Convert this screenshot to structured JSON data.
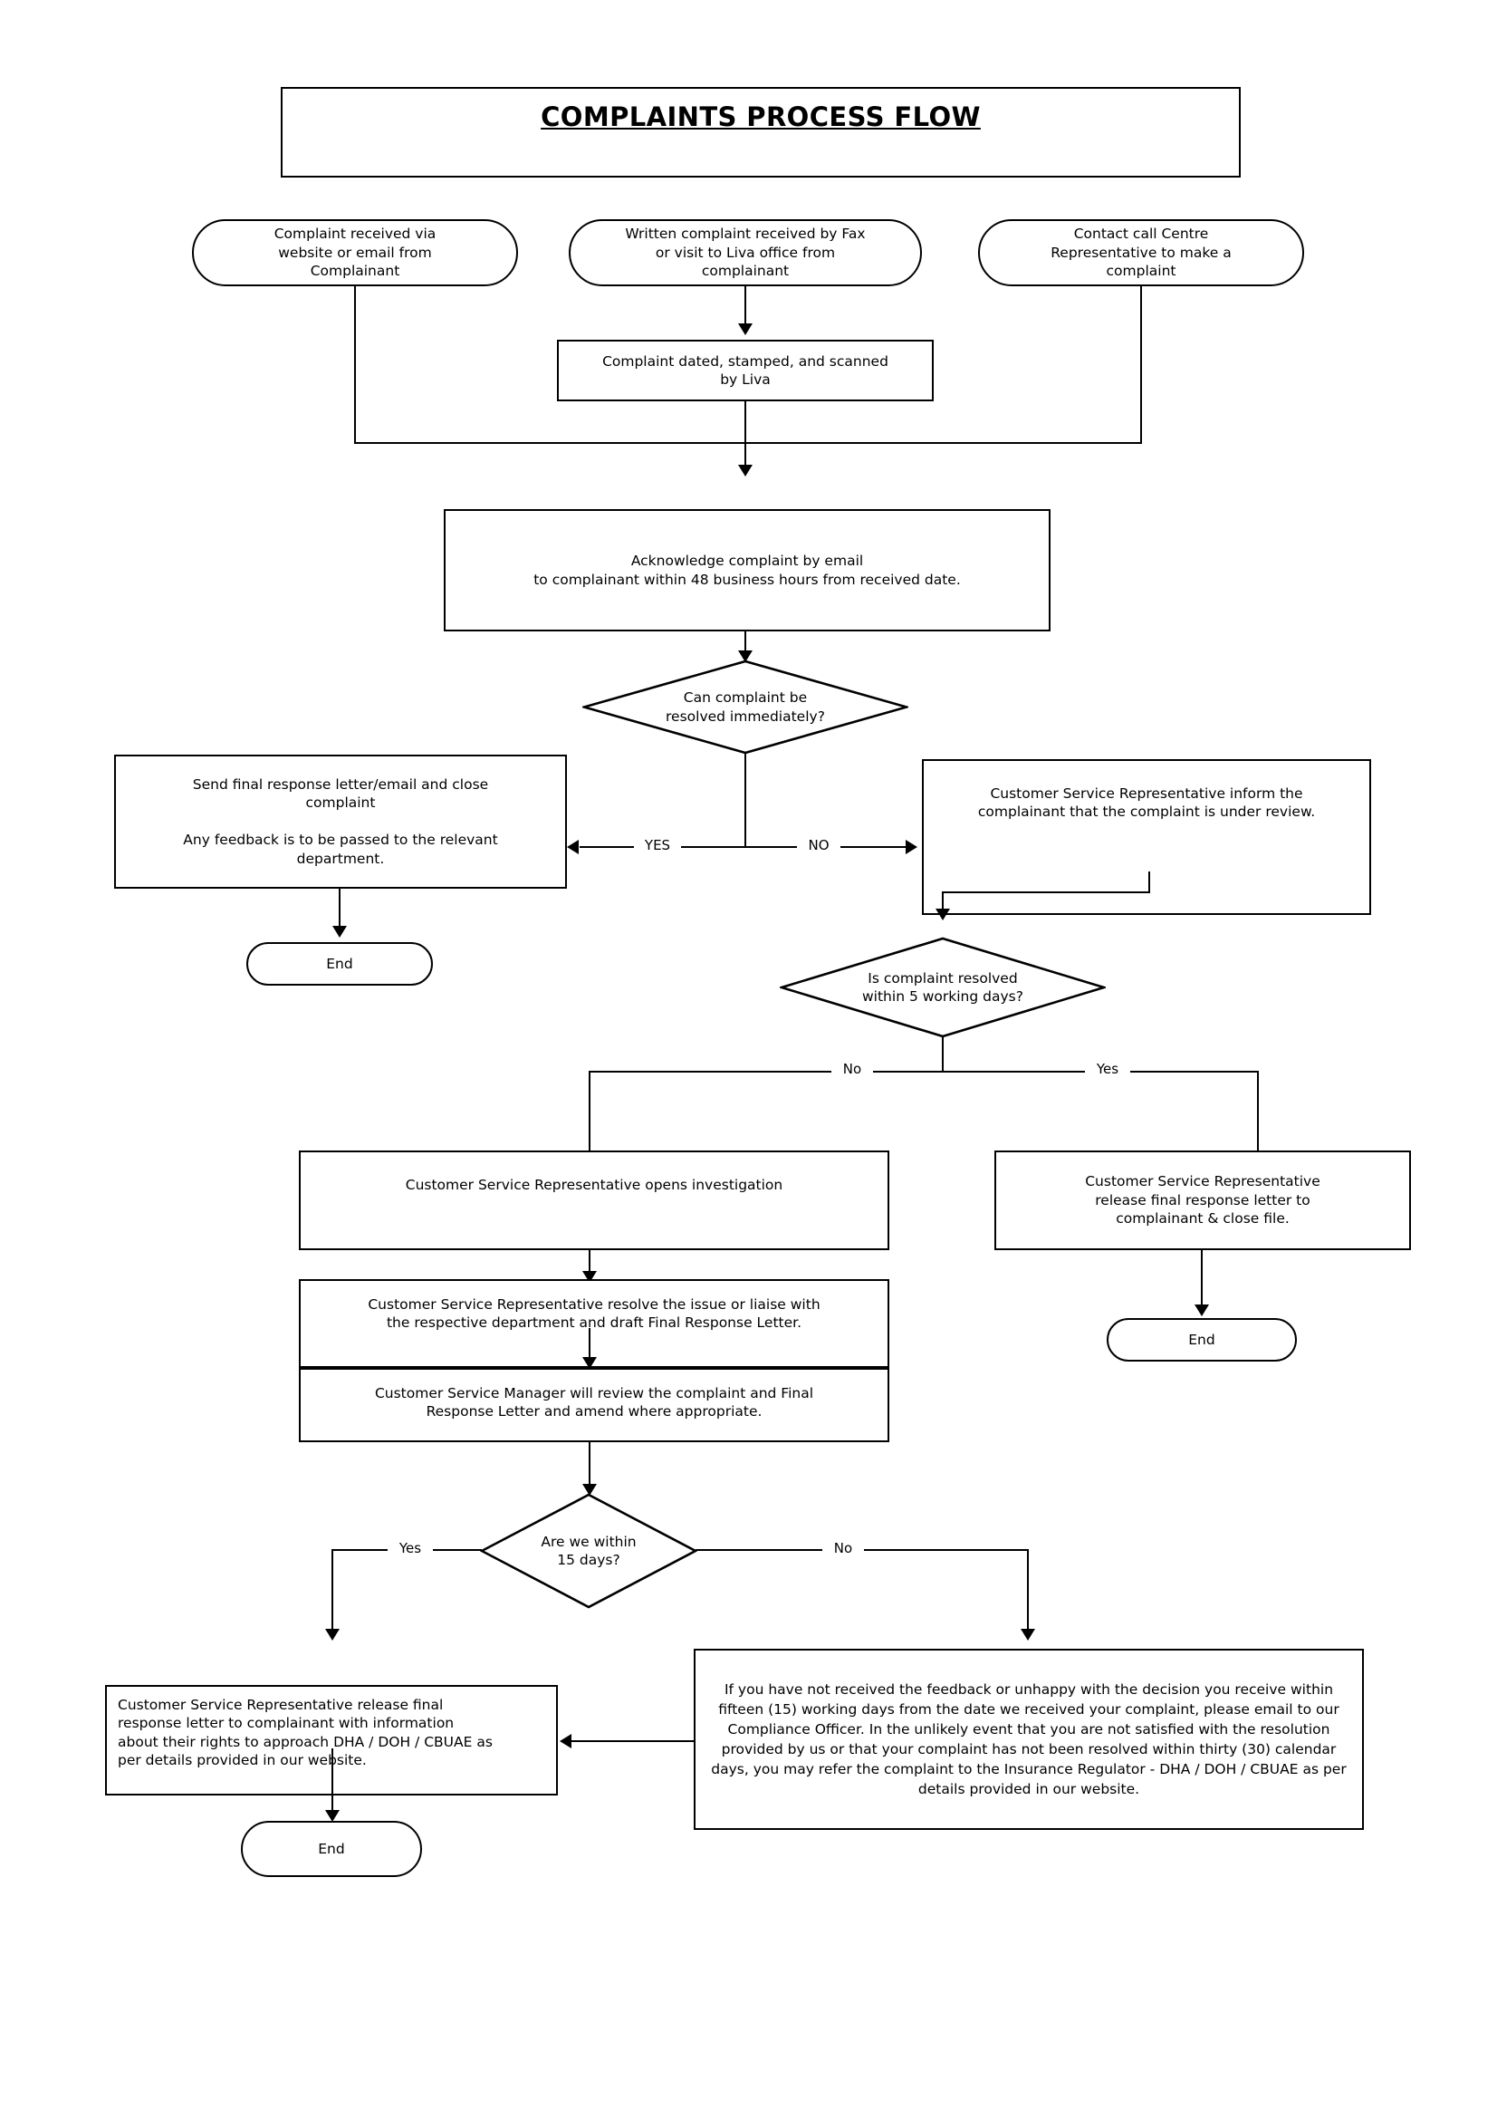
{
  "document": {
    "title": "COMPLAINTS PROCESS FLOW"
  },
  "chart_data": {
    "type": "diagram",
    "title": "COMPLAINTS PROCESS FLOW"
  },
  "nodes": {
    "start_web": "Complaint received via\nwebsite or email from\nComplainant",
    "start_fax": "Written complaint received by Fax\nor visit to Liva office from\ncomplainant",
    "start_call": "Contact call Centre\nRepresentative to make a\ncomplaint",
    "dated_stamped": "Complaint dated, stamped, and scanned\nby Liva",
    "acknowledge": "Acknowledge complaint by email\nto complainant within 48 business hours from received date.",
    "decision_immediate": "Can complaint be\nresolved immediately?",
    "send_final_response": "Send final response letter/email and close\ncomplaint\n\nAny feedback is to be passed to the relevant\ndepartment.",
    "end_left": "End",
    "csr_inform": "Customer Service Representative inform the\ncomplainant that the complaint is under review.",
    "decision_five_days": "Is complaint resolved\nwithin 5 working days?",
    "csr_opens_investigation": "Customer Service Representative opens investigation",
    "csr_resolve_issue": "Customer Service Representative resolve the issue or liaise with\nthe respective department and draft Final Response Letter.",
    "csm_review": "Customer Service Manager will review the complaint and Final\nResponse Letter and amend where appropriate.",
    "csr_release_letter": "Customer Service Representative\nrelease final response letter to\ncomplainant & close file.",
    "end_right": "End",
    "decision_fifteen_days": "Are we within\n15 days?",
    "csr_release_rights": "Customer Service Representative release final\nresponse letter to complainant with information\nabout their rights to approach DHA / DOH / CBUAE as\nper details provided in our website.",
    "escalation_note": "If you have not received the feedback or unhappy with the decision you receive within fifteen (15) working days from the date we received your complaint, please email to our Compliance Officer. In the unlikely event that you are not satisfied with the resolution provided by us or that your complaint has not been resolved within thirty (30) calendar days, you may refer the complaint to the Insurance Regulator - DHA / DOH / CBUAE as per details provided in our website.",
    "end_bottom": "End"
  },
  "edge_labels": {
    "immediate_yes": "YES",
    "immediate_no": "NO",
    "five_days_no": "No",
    "five_days_yes": "Yes",
    "fifteen_days_yes": "Yes",
    "fifteen_days_no": "No"
  },
  "colors": {
    "line": "#000000",
    "fill": "#ffffff",
    "text": "#000000"
  }
}
